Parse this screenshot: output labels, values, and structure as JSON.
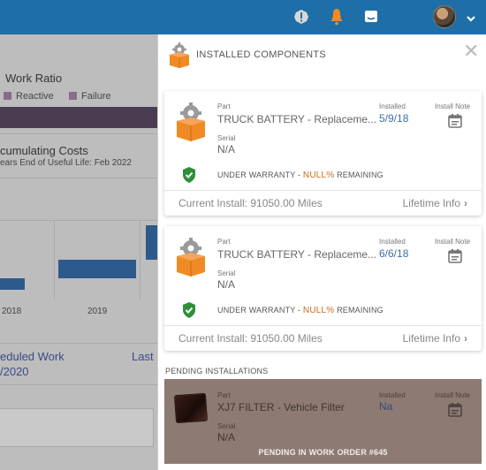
{
  "dashboard": {
    "work_ratio_title": "Work Ratio",
    "legend": [
      "Reactive",
      "Failure"
    ],
    "accum_title": "cumulating Costs",
    "accum_sub": "ears   End of Useful Life: Feb 2022",
    "x_ticks": [
      "2018",
      "2019"
    ],
    "scheduled_title": "eduled Work",
    "scheduled_date": "/2020",
    "last_label": "Last"
  },
  "panel": {
    "title": "INSTALLED COMPONENTS",
    "cards": [
      {
        "part_label": "Part",
        "part_value": "TRUCK BATTERY - Replaceme...",
        "serial_label": "Serial",
        "serial_value": "N/A",
        "installed_label": "Installed",
        "installed_value": "5/9/18",
        "install_note_label": "Install Note",
        "warranty_prefix": "UNDER WARRANTY -",
        "warranty_value": "NULL%",
        "warranty_suffix": "REMAINING",
        "current_install": "Current Install: 91050.00 Miles",
        "lifetime_info": "Lifetime Info"
      },
      {
        "part_label": "Part",
        "part_value": "TRUCK BATTERY - Replaceme...",
        "serial_label": "Serial",
        "serial_value": "N/A",
        "installed_label": "Installed",
        "installed_value": "6/6/18",
        "install_note_label": "Install Note",
        "warranty_prefix": "UNDER WARRANTY -",
        "warranty_value": "NULL%",
        "warranty_suffix": "REMAINING",
        "current_install": "Current Install: 91050.00 Miles",
        "lifetime_info": "Lifetime Info"
      }
    ],
    "pending_title": "PENDING INSTALLATIONS",
    "pending": {
      "part_label": "Part",
      "part_value": "XJ7 FILTER - Vehicle Filter",
      "serial_label": "Serial",
      "serial_value": "N/A",
      "installed_label": "Installed",
      "installed_value": "Na",
      "install_note_label": "Install Note",
      "message": "PENDING IN WORK ORDER #645"
    }
  },
  "colors": {
    "topbar": "#1e6fa8",
    "accent_orange": "#f08a24",
    "link_blue": "#3d6fa5",
    "warranty_green": "#2f8f3a"
  },
  "icons": {
    "topbar": [
      "alert-icon",
      "bell-icon",
      "chat-icon",
      "chevron-down-icon"
    ],
    "component": "gear-box-icon",
    "note": "calendar-note-icon",
    "warranty": "shield-check-icon",
    "close": "close-icon"
  }
}
